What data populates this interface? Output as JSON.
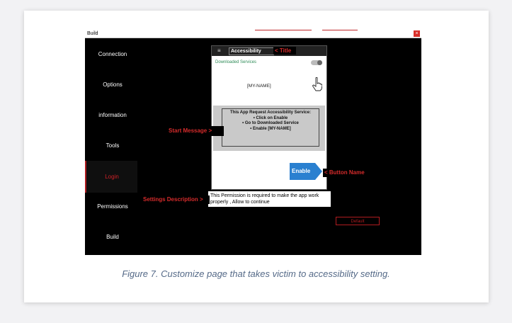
{
  "window": {
    "title": "Build",
    "close_glyph": "×"
  },
  "sidebar": {
    "items": [
      {
        "label": "Connection"
      },
      {
        "label": "Options"
      },
      {
        "label": "information"
      },
      {
        "label": "Tools"
      },
      {
        "label": "Login"
      },
      {
        "label": "Permissions"
      },
      {
        "label": "Build"
      }
    ]
  },
  "phone": {
    "menu_icon": "≡",
    "title": "Accessibility",
    "downloaded_services": "Downloaded Services",
    "my_name": "[MY-NAME]",
    "message_lines": [
      "This App Request Accessibility Service:",
      "• Click on Enable",
      "• Go to Downloaded Service",
      "• Enable [MY-NAME]"
    ],
    "enable_button": "Enable"
  },
  "settings_description": "This Permission is required to make the app work properly , Allow to continue",
  "annotations": {
    "title": "< Title",
    "start_message": "Start Message >",
    "button_name": "< Button Name",
    "settings_description": "Settings Description >"
  },
  "default_button": "Default",
  "caption": "Figure 7. Customize page that takes victim to accessibility setting.",
  "colors": {
    "accent_red": "#cc2026",
    "enable_blue": "#2a80d0",
    "caption": "#556a88"
  }
}
